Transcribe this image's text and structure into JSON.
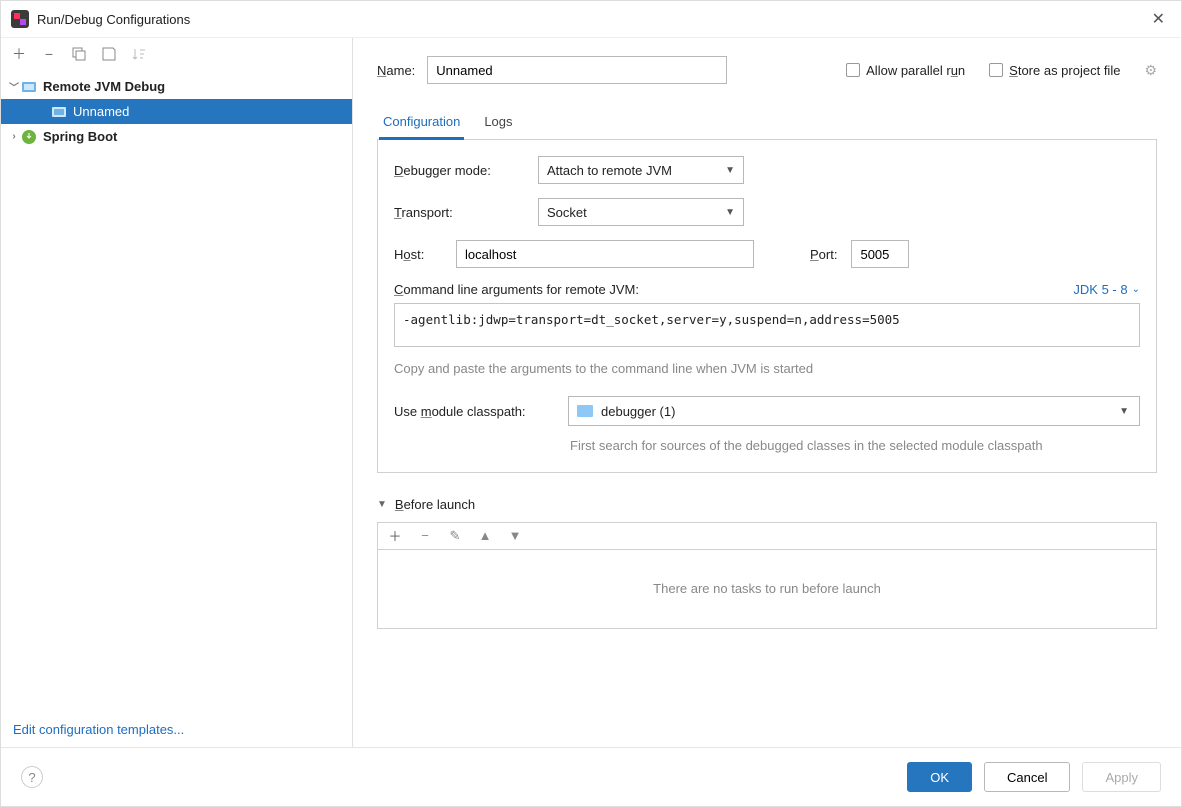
{
  "title": "Run/Debug Configurations",
  "tree": {
    "nodes": [
      {
        "label": "Remote JVM Debug",
        "expanded": true,
        "bold": true
      },
      {
        "label": "Unnamed",
        "child": true,
        "selected": true
      },
      {
        "label": "Spring Boot",
        "expanded": false,
        "bold": true
      }
    ]
  },
  "leftFooter": "Edit configuration templates...",
  "form": {
    "nameLabel": "Name:",
    "nameValue": "Unnamed",
    "allowParallel": "Allow parallel run",
    "storeAsProject": "Store as project file"
  },
  "tabs": [
    "Configuration",
    "Logs"
  ],
  "config": {
    "debuggerModeLabel": "Debugger mode:",
    "debuggerModeValue": "Attach to remote JVM",
    "transportLabel": "Transport:",
    "transportValue": "Socket",
    "hostLabel": "Host:",
    "hostValue": "localhost",
    "portLabel": "Port:",
    "portValue": "5005",
    "cmdLabel": "Command line arguments for remote JVM:",
    "jdkSelector": "JDK 5 - 8",
    "cmdValue": "-agentlib:jdwp=transport=dt_socket,server=y,suspend=n,address=5005",
    "cmdHint": "Copy and paste the arguments to the command line when JVM is started",
    "moduleLabel": "Use module classpath:",
    "moduleValue": "debugger (1)",
    "moduleHint": "First search for sources of the debugged classes in the selected module classpath"
  },
  "beforeLaunch": {
    "header": "Before launch",
    "empty": "There are no tasks to run before launch"
  },
  "buttons": {
    "ok": "OK",
    "cancel": "Cancel",
    "apply": "Apply"
  }
}
